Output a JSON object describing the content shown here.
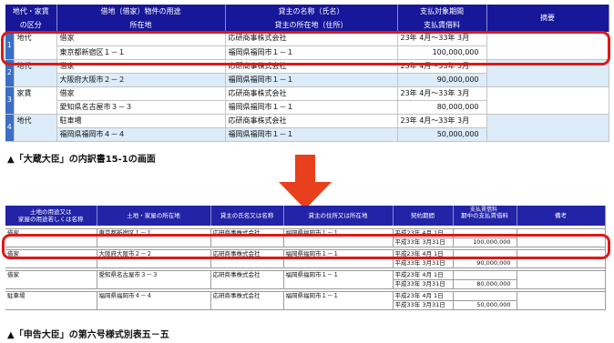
{
  "top_table": {
    "headers": {
      "kind_line1": "地代・家賃",
      "kind_line2": "の区分",
      "use_line1": "借地（借家）物件の用途",
      "use_line2": "所在地",
      "payee_line1": "貸主の名称（氏名）",
      "payee_line2": "貸主の所在地（住所）",
      "period_line1": "支払対象期間",
      "period_line2": "支払賃借料",
      "remarks": "摘要"
    },
    "rows": [
      {
        "num": "1",
        "kind": "地代",
        "use": "借家",
        "location": "東京都新宿区１－１",
        "payee": "応研商事株式会社",
        "payee_address": "福岡県福岡市１－１",
        "period": "23年  4月～33年  3月",
        "amount": "100,000,000"
      },
      {
        "num": "2",
        "kind": "地代",
        "use": "借家",
        "location": "大阪府大阪市２－２",
        "payee": "応研商事株式会社",
        "payee_address": "福岡県福岡市１－１",
        "period": "23年  4月～33年  3月",
        "amount": "90,000,000"
      },
      {
        "num": "3",
        "kind": "家賃",
        "use": "借家",
        "location": "愛知県名古屋市３－３",
        "payee": "応研商事株式会社",
        "payee_address": "福岡県福岡市１－１",
        "period": "23年  4月～33年  3月",
        "amount": "80,000,000"
      },
      {
        "num": "4",
        "kind": "地代",
        "use": "駐車場",
        "location": "福岡県福岡市４－４",
        "payee": "応研商事株式会社",
        "payee_address": "福岡県福岡市１－１",
        "period": "23年  4月～33年  3月",
        "amount": "50,000,000"
      }
    ],
    "caption": "▲「大蔵大臣」の内訳書15-1の画面"
  },
  "bottom_table": {
    "group_title": "支払賃借料",
    "headers": {
      "use_line1": "土地の用途又は",
      "use_line2": "家屋の用途若しくは名称",
      "location": "土地・家屋の所在地",
      "payee_name": "貸主の氏名又は名称",
      "payee_address": "貸主の住所又は所在地",
      "period": "契約期間",
      "amount": "期中の支払賃借料",
      "remarks": "備考"
    },
    "rows": [
      {
        "use": "借家",
        "location": "東京都新宿区１－１",
        "payee": "応研商事株式会社",
        "payee_address": "福岡県福岡市１－１",
        "start": "平成23年  4月  1日",
        "end": "平成33年  3月31日",
        "amount": "100,000,000"
      },
      {
        "use": "借家",
        "location": "大阪府大阪市２－２",
        "payee": "応研商事株式会社",
        "payee_address": "福岡県福岡市１－１",
        "start": "平成23年  4月  1日",
        "end": "平成33年  3月31日",
        "amount": "90,000,000"
      },
      {
        "use": "借家",
        "location": "愛知県名古屋市３－３",
        "payee": "応研商事株式会社",
        "payee_address": "福岡県福岡市１－１",
        "start": "平成23年  4月  1日",
        "end": "平成33年  3月31日",
        "amount": "80,000,000"
      },
      {
        "use": "駐車場",
        "location": "福岡県福岡市４－４",
        "payee": "応研商事株式会社",
        "payee_address": "福岡県福岡市１－１",
        "start": "平成23年  4月  1日",
        "end": "平成33年  3月31日",
        "amount": "50,000,000"
      }
    ],
    "caption": "▲「申告大臣」の第六号様式別表五－五"
  },
  "colors": {
    "header_navy": "#17179a",
    "row_blue": "#dcecf8",
    "number_blue": "#3a6fc4",
    "highlight_red": "#e01818",
    "arrow_red": "#e8401c"
  },
  "icons": {
    "arrow": "down-arrow-icon"
  }
}
